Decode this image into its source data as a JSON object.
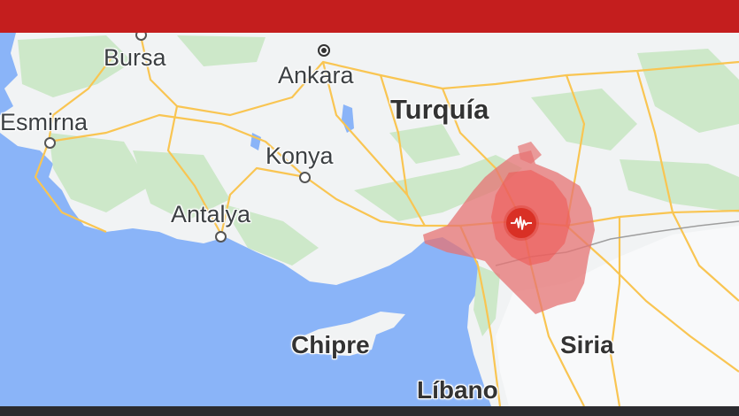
{
  "colors": {
    "topbar": "#c41e1e",
    "sea": "#8ab4f8",
    "land": "#f1f3f4",
    "green": "#cde8c9",
    "road": "#f9c552",
    "quake_zone": "#e57373",
    "quake_marker": "#d93025"
  },
  "labels": {
    "bursa": "Bursa",
    "ankara": "Ankara",
    "esmirna": "Esmirna",
    "turquia": "Turquía",
    "konya": "Konya",
    "antalya": "Antalya",
    "chipre": "Chipre",
    "siria": "Siria",
    "libano": "Líbano"
  },
  "icons": {
    "quake": "seismograph-icon"
  }
}
